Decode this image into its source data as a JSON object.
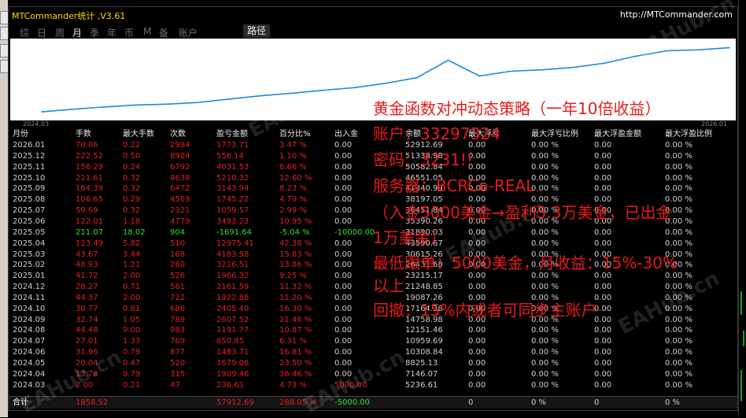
{
  "window": {
    "title": "MTCommander统计 ,V3.61",
    "url": "http://MTCommander.com"
  },
  "period_tabs": [
    "综",
    "日",
    "周",
    "月",
    "季",
    "年",
    "币",
    "M",
    "备",
    "账户"
  ],
  "active_tab": "月",
  "path_button": "路径",
  "chart": {
    "start_label": "2024.03",
    "end_label": "2026.01",
    "line_color": "#1f8ad8",
    "background": "#ffffff"
  },
  "chart_data": {
    "type": "line",
    "x": [
      "2024.03",
      "2024.04",
      "2024.05",
      "2024.06",
      "2024.07",
      "2024.08",
      "2024.09",
      "2024.10",
      "2024.11",
      "2024.12",
      "2025.01",
      "2025.02",
      "2025.03",
      "2025.04",
      "2025.05",
      "2025.06",
      "2025.07",
      "2025.08",
      "2025.09",
      "2025.10",
      "2025.11",
      "2025.12",
      "2026.01"
    ],
    "y": [
      5236.61,
      7146.07,
      8825.13,
      10308.84,
      10959.69,
      12151.46,
      14758.98,
      17164.38,
      19087.26,
      21248.85,
      23215.17,
      26431.68,
      30615.26,
      43590.67,
      31890.03,
      35390.26,
      36451.84,
      38197.05,
      41340.99,
      46551.05,
      50582.84,
      51338.98,
      52912.69
    ],
    "ylim": [
      0,
      55000
    ]
  },
  "columns": [
    "月份",
    "手数",
    "最大手数",
    "次数",
    "盈亏金额",
    "百分比%",
    "出入金",
    "余额",
    "最大浮亏",
    "最大浮亏比例",
    "最大浮盈金额",
    "最大浮盈比例"
  ],
  "rows": [
    [
      "2026.01",
      "70.06",
      "0.22",
      "2984",
      "1773.71",
      "3.47 %",
      "0.00",
      "52912.69",
      "0.00",
      "0.00 %",
      "0.00",
      "0.00 %"
    ],
    [
      "2025.12",
      "222.52",
      "0.50",
      "8904",
      "556.14",
      "1.10 %",
      "0.00",
      "51338.98",
      "0.00",
      "0.00 %",
      "0.00",
      "0.00 %"
    ],
    [
      "2025.11",
      "156.29",
      "0.24",
      "6792",
      "4031.53",
      "8.66 %",
      "0.00",
      "50582.84",
      "0.00",
      "0.00 %",
      "0.00",
      "0.00 %"
    ],
    [
      "2025.10",
      "211.61",
      "0.32",
      "8638",
      "5210.32",
      "12.60 %",
      "0.00",
      "46551.05",
      "0.00",
      "0.00 %",
      "0.00",
      "0.00 %"
    ],
    [
      "2025.09",
      "164.39",
      "0.32",
      "6472",
      "3143.94",
      "8.23 %",
      "0.00",
      "41340.99",
      "0.00",
      "0.00 %",
      "0.00",
      "0.00 %"
    ],
    [
      "2025.08",
      "106.65",
      "0.29",
      "4569",
      "1745.22",
      "4.79 %",
      "0.00",
      "38197.05",
      "0.00",
      "0.00 %",
      "0.00",
      "0.00 %"
    ],
    [
      "2025.07",
      "59.69",
      "0.32",
      "2321",
      "1059.57",
      "2.99 %",
      "0.00",
      "36451.84",
      "0.00",
      "0.00 %",
      "0.00",
      "0.00 %"
    ],
    [
      "2025.06",
      "122.01",
      "1.18",
      "4779",
      "3493.23",
      "10.95 %",
      "0.00",
      "35390.26",
      "0.00",
      "0.00 %",
      "0.00",
      "0.00 %"
    ],
    [
      "2025.05",
      "211.07",
      "18.02",
      "904",
      "-1691.64",
      "-5.04 %",
      "-10000.00",
      "31890.03",
      "0.00",
      "0.00 %",
      "0.00",
      "0.00 %"
    ],
    [
      "2025.04",
      "123.49",
      "5.82",
      "510",
      "12975.41",
      "42.38 %",
      "0.00",
      "43590.67",
      "0.00",
      "0.00 %",
      "0.00",
      "0.00 %"
    ],
    [
      "2025.03",
      "43.67",
      "3.44",
      "168",
      "4183.58",
      "15.83 %",
      "0.00",
      "30615.26",
      "0.00",
      "0.00 %",
      "0.00",
      "0.00 %"
    ],
    [
      "2025.02",
      "48.93",
      "1.21",
      "260",
      "3216.51",
      "13.86 %",
      "0.00",
      "26431.68",
      "0.00",
      "0.00 %",
      "0.00",
      "0.00 %"
    ],
    [
      "2025.01",
      "41.72",
      "2.00",
      "526",
      "1966.32",
      "9.25 %",
      "0.00",
      "23215.17",
      "0.00",
      "0.00 %",
      "0.00",
      "0.00 %"
    ],
    [
      "2024.12",
      "28.27",
      "0.71",
      "561",
      "2161.59",
      "11.32 %",
      "0.00",
      "21248.85",
      "0.00",
      "0.00 %",
      "0.00",
      "0.00 %"
    ],
    [
      "2024.11",
      "44.37",
      "2.00",
      "722",
      "1922.88",
      "11.20 %",
      "0.00",
      "19087.26",
      "0.00",
      "0.00 %",
      "0.00",
      "0.00 %"
    ],
    [
      "2024.10",
      "30.77",
      "0.81",
      "686",
      "2405.40",
      "16.30 %",
      "0.00",
      "17164.38",
      "0.00",
      "0.00 %",
      "0.00",
      "0.00 %"
    ],
    [
      "2024.09",
      "32.74",
      "1.05",
      "789",
      "2607.52",
      "21.46 %",
      "0.00",
      "14758.98",
      "0.00",
      "0.00 %",
      "0.00",
      "0.00 %"
    ],
    [
      "2024.08",
      "44.48",
      "9.00",
      "983",
      "1191.77",
      "10.87 %",
      "0.00",
      "12151.46",
      "0.00",
      "0.00 %",
      "0.00",
      "0.00 %"
    ],
    [
      "2024.07",
      "27.01",
      "1.33",
      "769",
      "650.85",
      "6.31 %",
      "0.00",
      "10959.69",
      "0.00",
      "0.00 %",
      "0.00",
      "0.00 %"
    ],
    [
      "2024.06",
      "31.96",
      "0.79",
      "877",
      "1483.71",
      "16.81 %",
      "0.00",
      "10308.84",
      "0.00",
      "0.00 %",
      "0.00",
      "0.00 %"
    ],
    [
      "2024.05",
      "20.04",
      "0.47",
      "520",
      "1679.06",
      "23.50 %",
      "0.00",
      "8825.13",
      "0.00",
      "0.00 %",
      "0.00",
      "0.00 %"
    ],
    [
      "2024.04",
      "13.78",
      "0.79",
      "315",
      "1909.46",
      "36.46 %",
      "0.00",
      "7146.07",
      "0.00",
      "0.00 %",
      "0.00",
      "0.00 %"
    ],
    [
      "2024.03",
      "2.00",
      "0.21",
      "47",
      "236.61",
      "4.73 %",
      "5000.00",
      "5236.61",
      "0.00",
      "0.00 %",
      "0.00",
      "0.00 %"
    ]
  ],
  "total": {
    "label": "合计",
    "lots": "1858.52",
    "pnl": "57912.69",
    "pct": "288.05 %",
    "inout": "-5000.00",
    "maxdd": "0",
    "maxdd_pct": "0 %",
    "maxfp": "0",
    "maxfp_pct": "0 %"
  },
  "overlay_text": [
    "黄金函数对冲动态策略（一年10倍收益）",
    "账户：33297324",
    "密码：3231!!",
    "服务器：BCRCo-REAL",
    "（入金5000美金→盈利5.3万美金，已出金",
    "1万美金）",
    "最低跟单：5000美金，月收益：15%-30%",
    "以上",
    "回撤：15%内或者可同步主账户"
  ],
  "watermark": "EAHub.cn",
  "colors": {
    "title": "#ffd800",
    "positive": "#e02020",
    "negative": "#2ee02e",
    "overlay": "#e81a1a"
  }
}
